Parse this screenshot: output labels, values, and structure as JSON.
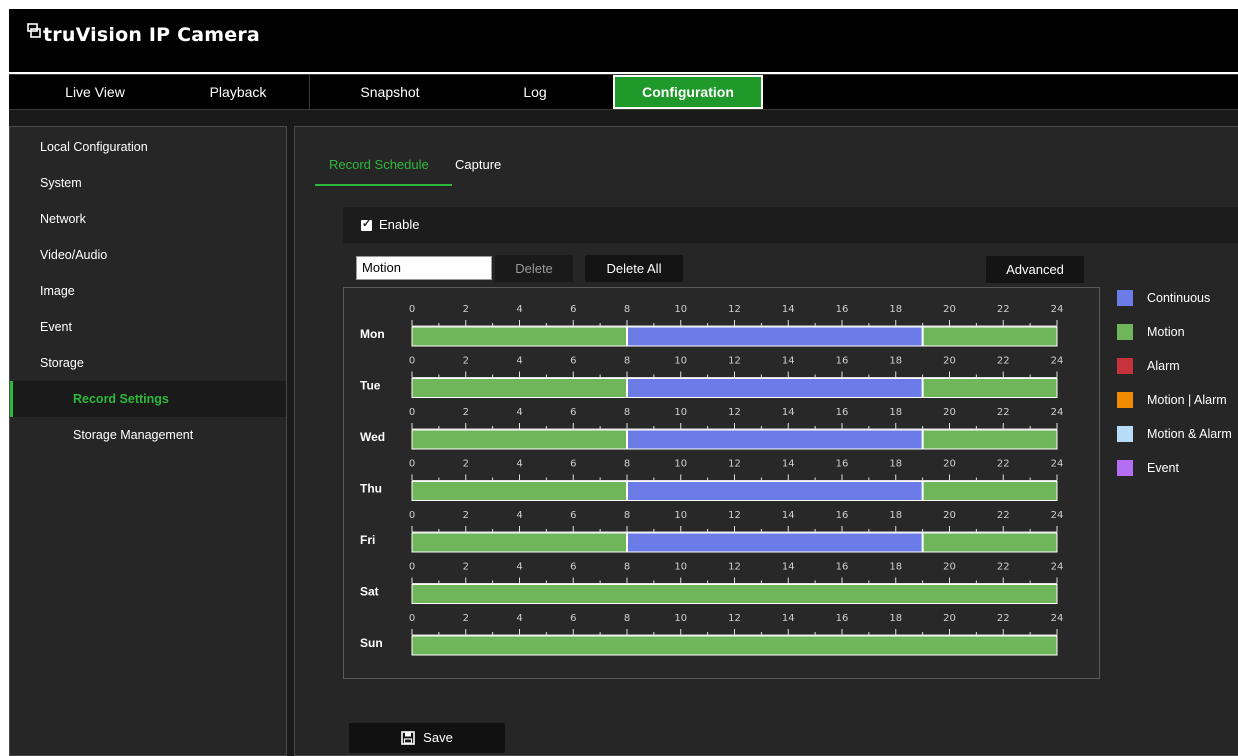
{
  "app": {
    "title": "truVision IP Camera"
  },
  "nav": {
    "items": [
      {
        "label": "Live View",
        "active": false
      },
      {
        "label": "Playback",
        "active": false
      },
      {
        "label": "Snapshot",
        "active": false
      },
      {
        "label": "Log",
        "active": false
      },
      {
        "label": "Configuration",
        "active": true
      }
    ]
  },
  "sidebar": {
    "items": [
      {
        "label": "Local Configuration",
        "sub": false,
        "active": false
      },
      {
        "label": "System",
        "sub": false,
        "active": false
      },
      {
        "label": "Network",
        "sub": false,
        "active": false
      },
      {
        "label": "Video/Audio",
        "sub": false,
        "active": false
      },
      {
        "label": "Image",
        "sub": false,
        "active": false
      },
      {
        "label": "Event",
        "sub": false,
        "active": false
      },
      {
        "label": "Storage",
        "sub": false,
        "active": false
      },
      {
        "label": "Record Settings",
        "sub": true,
        "active": true
      },
      {
        "label": "Storage Management",
        "sub": true,
        "active": false
      }
    ]
  },
  "tabs": {
    "record_schedule": "Record Schedule",
    "capture": "Capture"
  },
  "enable": {
    "label": "Enable",
    "checked": true
  },
  "toolbar": {
    "type_select": "Motion",
    "delete_label": "Delete",
    "delete_all_label": "Delete All",
    "advanced_label": "Advanced"
  },
  "schedule": {
    "ticks": [
      "0",
      "2",
      "4",
      "6",
      "8",
      "10",
      "12",
      "14",
      "16",
      "18",
      "20",
      "22",
      "24"
    ],
    "days": [
      {
        "day": "Mon",
        "segments": [
          {
            "start": 0,
            "end": 8,
            "type": "Motion"
          },
          {
            "start": 8,
            "end": 19,
            "type": "Continuous"
          },
          {
            "start": 19,
            "end": 24,
            "type": "Motion"
          }
        ]
      },
      {
        "day": "Tue",
        "segments": [
          {
            "start": 0,
            "end": 8,
            "type": "Motion"
          },
          {
            "start": 8,
            "end": 19,
            "type": "Continuous"
          },
          {
            "start": 19,
            "end": 24,
            "type": "Motion"
          }
        ]
      },
      {
        "day": "Wed",
        "segments": [
          {
            "start": 0,
            "end": 8,
            "type": "Motion"
          },
          {
            "start": 8,
            "end": 19,
            "type": "Continuous"
          },
          {
            "start": 19,
            "end": 24,
            "type": "Motion"
          }
        ]
      },
      {
        "day": "Thu",
        "segments": [
          {
            "start": 0,
            "end": 8,
            "type": "Motion"
          },
          {
            "start": 8,
            "end": 19,
            "type": "Continuous"
          },
          {
            "start": 19,
            "end": 24,
            "type": "Motion"
          }
        ]
      },
      {
        "day": "Fri",
        "segments": [
          {
            "start": 0,
            "end": 8,
            "type": "Motion"
          },
          {
            "start": 8,
            "end": 19,
            "type": "Continuous"
          },
          {
            "start": 19,
            "end": 24,
            "type": "Motion"
          }
        ]
      },
      {
        "day": "Sat",
        "segments": [
          {
            "start": 0,
            "end": 24,
            "type": "Motion"
          }
        ]
      },
      {
        "day": "Sun",
        "segments": [
          {
            "start": 0,
            "end": 24,
            "type": "Motion"
          }
        ]
      }
    ]
  },
  "legend": [
    {
      "label": "Continuous",
      "color": "#6b7ce8"
    },
    {
      "label": "Motion",
      "color": "#6fb65a"
    },
    {
      "label": "Alarm",
      "color": "#c7323d"
    },
    {
      "label": "Motion | Alarm",
      "color": "#f08a00"
    },
    {
      "label": "Motion & Alarm",
      "color": "#b7dcf7"
    },
    {
      "label": "Event",
      "color": "#b36ef2"
    }
  ],
  "save_label": "Save"
}
